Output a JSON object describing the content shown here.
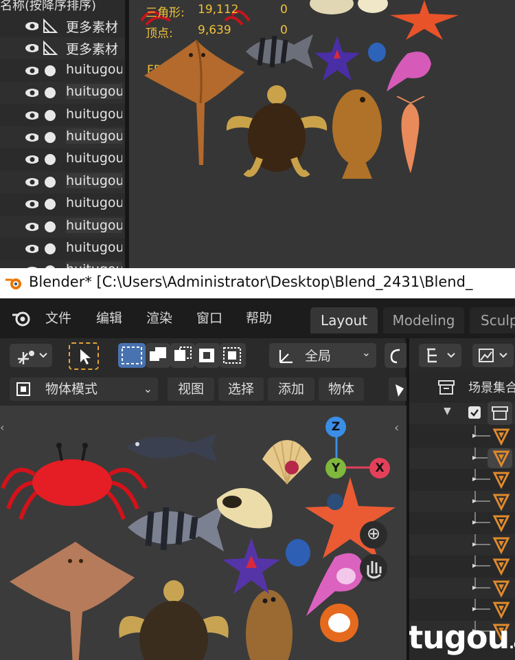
{
  "outliner": {
    "header": "名称(按降序排序)",
    "rows": [
      {
        "label": "更多素材",
        "kind": "mesh-data"
      },
      {
        "label": "更多素材",
        "kind": "mesh-data"
      },
      {
        "label": "huitugou",
        "kind": "object"
      },
      {
        "label": "huitugou",
        "kind": "object"
      },
      {
        "label": "huitugou",
        "kind": "object"
      },
      {
        "label": "huitugou",
        "kind": "object"
      },
      {
        "label": "huitugou",
        "kind": "object"
      },
      {
        "label": "huitugou",
        "kind": "object"
      },
      {
        "label": "huitugou",
        "kind": "object"
      },
      {
        "label": "huitugou",
        "kind": "object"
      },
      {
        "label": "huitugou",
        "kind": "object"
      },
      {
        "label": "huitugou",
        "kind": "object"
      }
    ]
  },
  "stats": {
    "triangles_label": "三角形:",
    "triangles_value": "19,112",
    "triangles_sel": "0",
    "vertices_label": "顶点:",
    "vertices_value": "9,639",
    "vertices_sel": "0",
    "fps_label": "FPS:"
  },
  "window": {
    "title": "Blender* [C:\\Users\\Administrator\\Desktop\\Blend_2431\\Blend_"
  },
  "menu": {
    "file": "文件",
    "edit": "编辑",
    "render": "渲染",
    "window": "窗口",
    "help": "帮助"
  },
  "workspaces": [
    "Layout",
    "Modeling",
    "Sculp"
  ],
  "toolbar": {
    "transform_orientation": "全局"
  },
  "header": {
    "mode": "物体模式",
    "view": "视图",
    "select": "选择",
    "add": "添加",
    "object": "物体"
  },
  "gizmo": {
    "z": "Z",
    "y": "Y",
    "x": "X"
  },
  "right_panel": {
    "scene_collection": "场景集合"
  },
  "watermark": {
    "text": "huitugou",
    "suffix": ".com"
  },
  "colors": {
    "stats": "#f0c23a",
    "accent_blue": "#4872b0",
    "object_orange": "#e08a2c",
    "gizmo_x": "#e3405a",
    "gizmo_y": "#7fb83c",
    "gizmo_z": "#3a8ee6"
  }
}
